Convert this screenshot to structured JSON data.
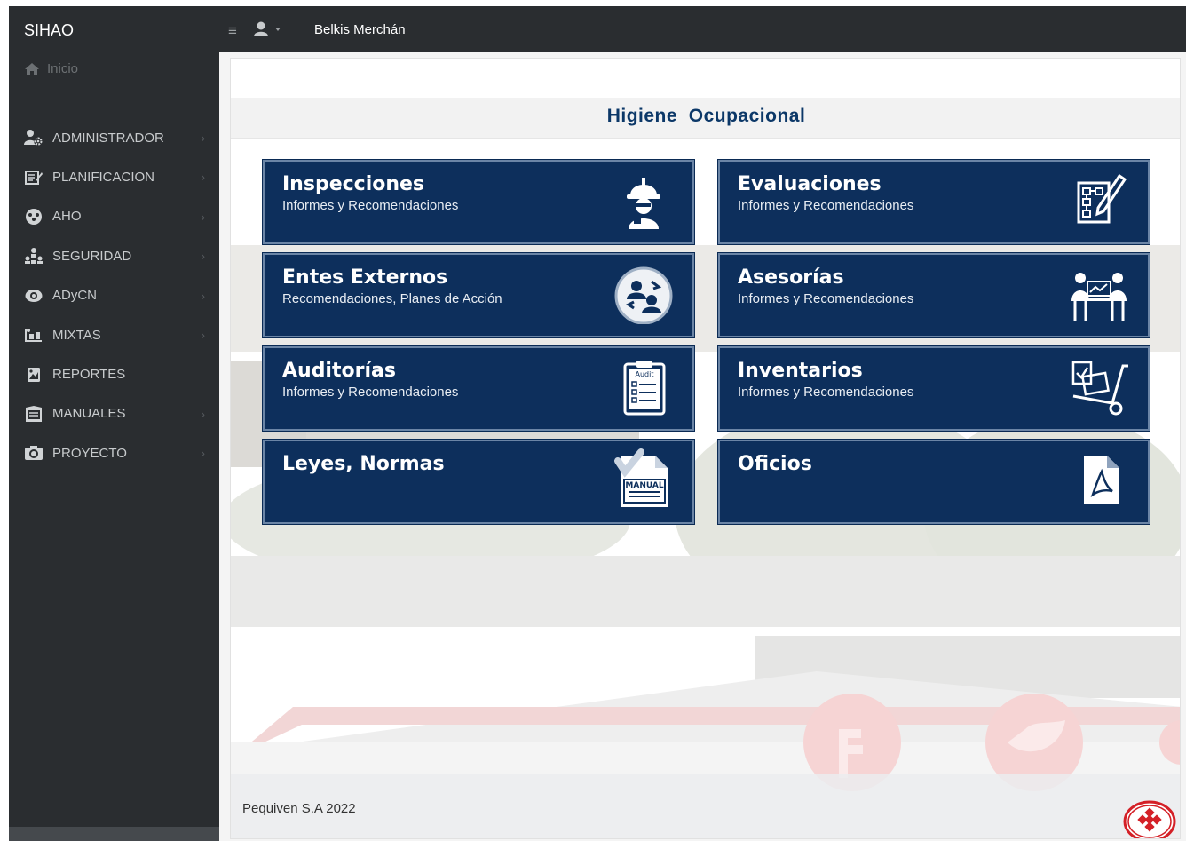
{
  "app": {
    "brand": "SIHAO",
    "home_label": "Inicio",
    "user_name": "Belkis Merchán"
  },
  "sidebar": {
    "items": [
      {
        "label": "ADMINISTRADOR",
        "icon": "admin-users-icon",
        "has_submenu": true
      },
      {
        "label": "PLANIFICACION",
        "icon": "planning-icon",
        "has_submenu": true
      },
      {
        "label": "AHO",
        "icon": "aho-icon",
        "has_submenu": true
      },
      {
        "label": "SEGURIDAD",
        "icon": "security-icon",
        "has_submenu": true
      },
      {
        "label": "ADyCN",
        "icon": "eye-icon",
        "has_submenu": true
      },
      {
        "label": "MIXTAS",
        "icon": "mixed-icon",
        "has_submenu": true
      },
      {
        "label": "REPORTES",
        "icon": "reports-icon",
        "has_submenu": false
      },
      {
        "label": "MANUALES",
        "icon": "manuals-icon",
        "has_submenu": true
      },
      {
        "label": "PROYECTO",
        "icon": "camera-icon",
        "has_submenu": true
      }
    ]
  },
  "main": {
    "title_word1": "Higiene",
    "title_word2": "Ocupacional",
    "cards": [
      {
        "title": "Inspecciones",
        "subtitle": "Informes y Recomendaciones",
        "icon": "inspector-helmet-icon"
      },
      {
        "title": "Evaluaciones",
        "subtitle": "Informes y Recomendaciones",
        "icon": "evaluation-flowchart-icon"
      },
      {
        "title": "Entes Externos",
        "subtitle": "Recomendaciones, Planes de Acción",
        "icon": "external-entities-icon"
      },
      {
        "title": "Asesorías",
        "subtitle": "Informes y Recomendaciones",
        "icon": "consulting-meeting-icon"
      },
      {
        "title": "Auditorías",
        "subtitle": "Informes y Recomendaciones",
        "icon": "audit-clipboard-icon",
        "icon_text": "Audit"
      },
      {
        "title": "Inventarios",
        "subtitle": "Informes y Recomendaciones",
        "icon": "inventory-cart-icon"
      },
      {
        "title": "Leyes, Normas",
        "subtitle": "",
        "icon": "manual-document-icon",
        "icon_text": "MANUAL"
      },
      {
        "title": "Oficios",
        "subtitle": "",
        "icon": "pdf-document-icon"
      }
    ]
  },
  "footer": {
    "text": "Pequiven S.A 2022"
  },
  "colors": {
    "sidebar_bg": "#2a2d30",
    "card_bg": "#0d2f5c",
    "title_color": "#0c3868",
    "accent_red": "#d42027"
  }
}
